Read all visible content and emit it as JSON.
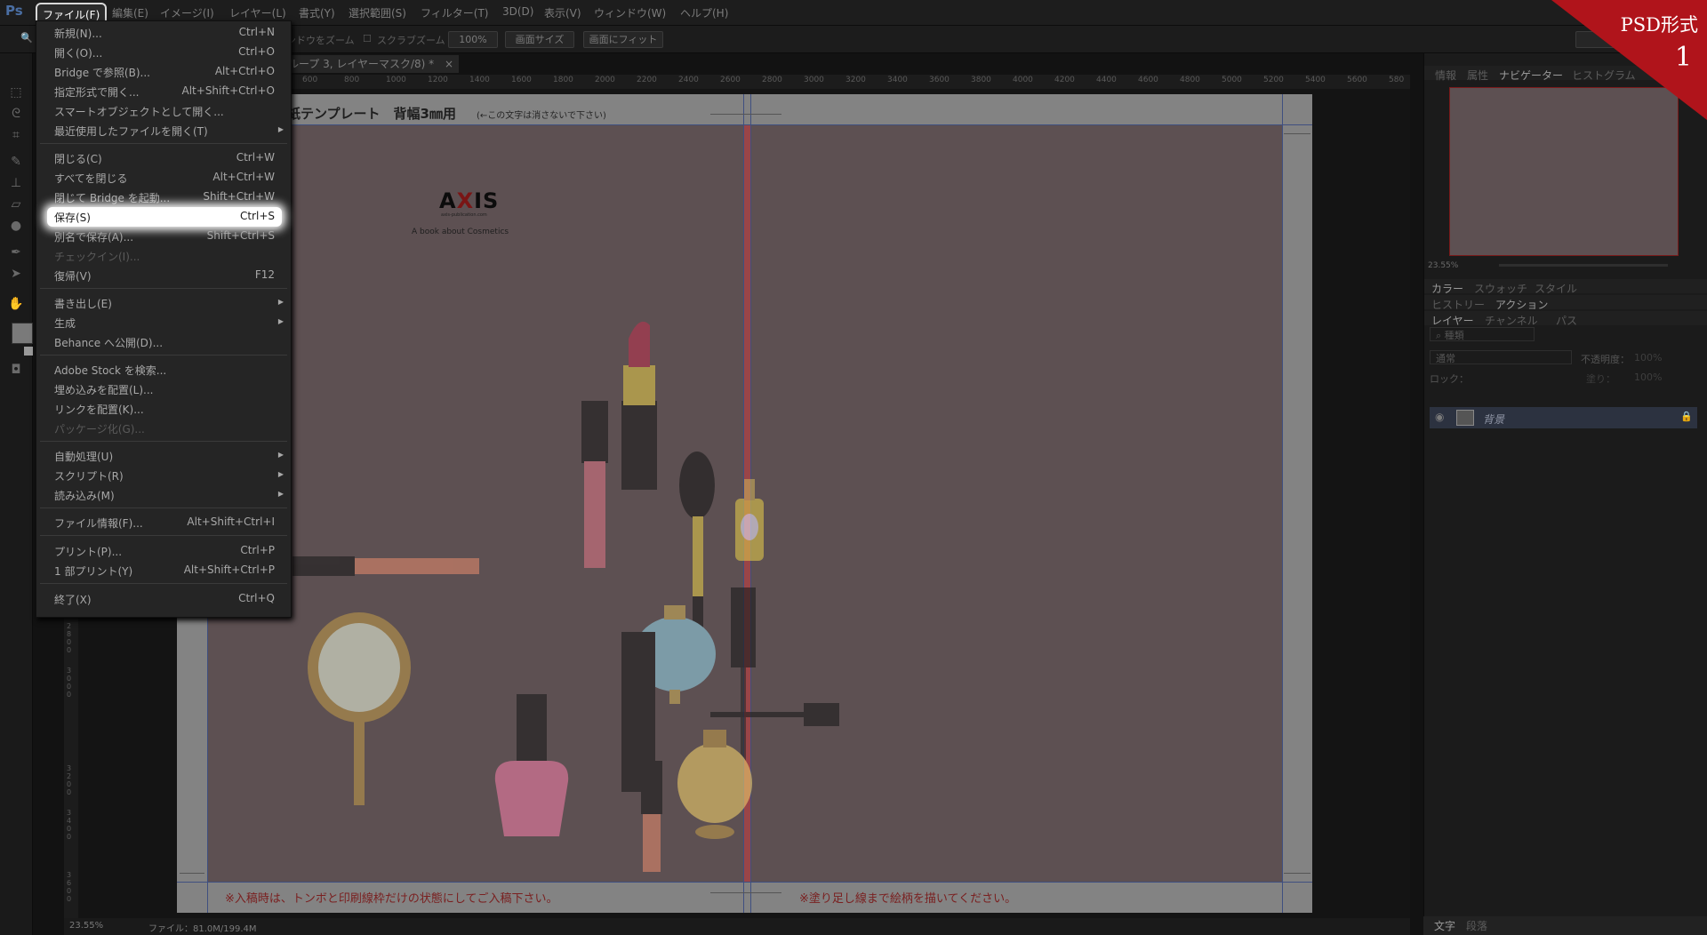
{
  "app": {
    "name": "Ps"
  },
  "menubar": {
    "file": "ファイル(F)",
    "edit": "編集(E)",
    "image": "イメージ(I)",
    "layer": "レイヤー(L)",
    "type": "書式(Y)",
    "select": "選択範囲(S)",
    "filter": "フィルター(T)",
    "3d": "3D(D)",
    "view": "表示(V)",
    "window": "ウィンドウ(W)",
    "help": "ヘルプ(H)"
  },
  "options": {
    "zoom_windows": "ンドウをズーム",
    "scrubby": "スクラブズーム",
    "zoom_percent": "100%",
    "screen_size": "画面サイズ",
    "fit_screen": "画面にフィット"
  },
  "document": {
    "tab_title": "ループ 3, レイヤーマスク/8) *",
    "tab_close": "×",
    "ruler_ticks": [
      "600",
      "800",
      "1000",
      "1200",
      "1400",
      "1600",
      "1800",
      "2000",
      "2200",
      "2400",
      "2600",
      "2800",
      "3000",
      "3200",
      "3400",
      "3600",
      "3800",
      "4000",
      "4200",
      "4400",
      "4600",
      "4800",
      "5000",
      "5200",
      "5400",
      "5600",
      "580"
    ]
  },
  "artwork": {
    "template_title": "紙テンプレート　背幅3㎜用",
    "template_note": "(←この文字は消さないで下さい)",
    "logo_a": "A",
    "logo_x": "X",
    "logo_is": "IS",
    "logo_url": "axis-publication.com",
    "tagline": "A  book about  Cosmetics",
    "warning_left": "※入稿時は、トンボと印刷線枠だけの状態にしてご入稿下さい。",
    "warning_right": "※塗り足し線まで絵柄を描いてください。"
  },
  "file_menu": {
    "new": "新規(N)...",
    "new_sc": "Ctrl+N",
    "open": "開く(O)...",
    "open_sc": "Ctrl+O",
    "bridge": "Bridge で参照(B)...",
    "bridge_sc": "Alt+Ctrl+O",
    "open_as": "指定形式で開く...",
    "open_as_sc": "Alt+Shift+Ctrl+O",
    "open_smart": "スマートオブジェクトとして開く...",
    "recent": "最近使用したファイルを開く(T)",
    "close": "閉じる(C)",
    "close_sc": "Ctrl+W",
    "close_all": "すべてを閉じる",
    "close_all_sc": "Alt+Ctrl+W",
    "close_bridge": "閉じて Bridge を起動...",
    "close_bridge_sc": "Shift+Ctrl+W",
    "save": "保存(S)",
    "save_sc": "Ctrl+S",
    "save_as": "別名で保存(A)...",
    "save_as_sc": "Shift+Ctrl+S",
    "checkin": "チェックイン(I)...",
    "revert": "復帰(V)",
    "revert_sc": "F12",
    "export": "書き出し(E)",
    "generate": "生成",
    "behance": "Behance へ公開(D)...",
    "stock": "Adobe Stock を検索...",
    "place_embed": "埋め込みを配置(L)...",
    "place_link": "リンクを配置(K)...",
    "package": "パッケージ化(G)...",
    "automate": "自動処理(U)",
    "scripts": "スクリプト(R)",
    "import": "読み込み(M)",
    "file_info": "ファイル情報(F)...",
    "file_info_sc": "Alt+Shift+Ctrl+I",
    "print": "プリント(P)...",
    "print_sc": "Ctrl+P",
    "print_one": "1 部プリント(Y)",
    "print_one_sc": "Alt+Shift+Ctrl+P",
    "exit": "終了(X)",
    "exit_sc": "Ctrl+Q"
  },
  "panels": {
    "top_tabs": [
      "情報",
      "属性",
      "ナビゲーター",
      "ヒストグラム"
    ],
    "nav_zoom": "23.55%",
    "color_tabs": [
      "カラー",
      "スウォッチ",
      "スタイル"
    ],
    "history_tabs": [
      "ヒストリー",
      "アクション"
    ],
    "layer_tabs": [
      "レイヤー",
      "チャンネル",
      "パス"
    ],
    "kind_filter": "種類",
    "blend_mode": "通常",
    "opacity_label": "不透明度：",
    "opacity_value": "100%",
    "lock_label": "ロック：",
    "fill_label": "塗り：",
    "fill_value": "100%",
    "layer_name": "背景",
    "bottom_tabs": [
      "文字",
      "段落"
    ]
  },
  "status": {
    "zoom": "23.55%",
    "file": "ファイル：81.0M/199.4M"
  },
  "badge": {
    "line1": "PSD形式",
    "line2": "1",
    "color": "#b0141b"
  }
}
